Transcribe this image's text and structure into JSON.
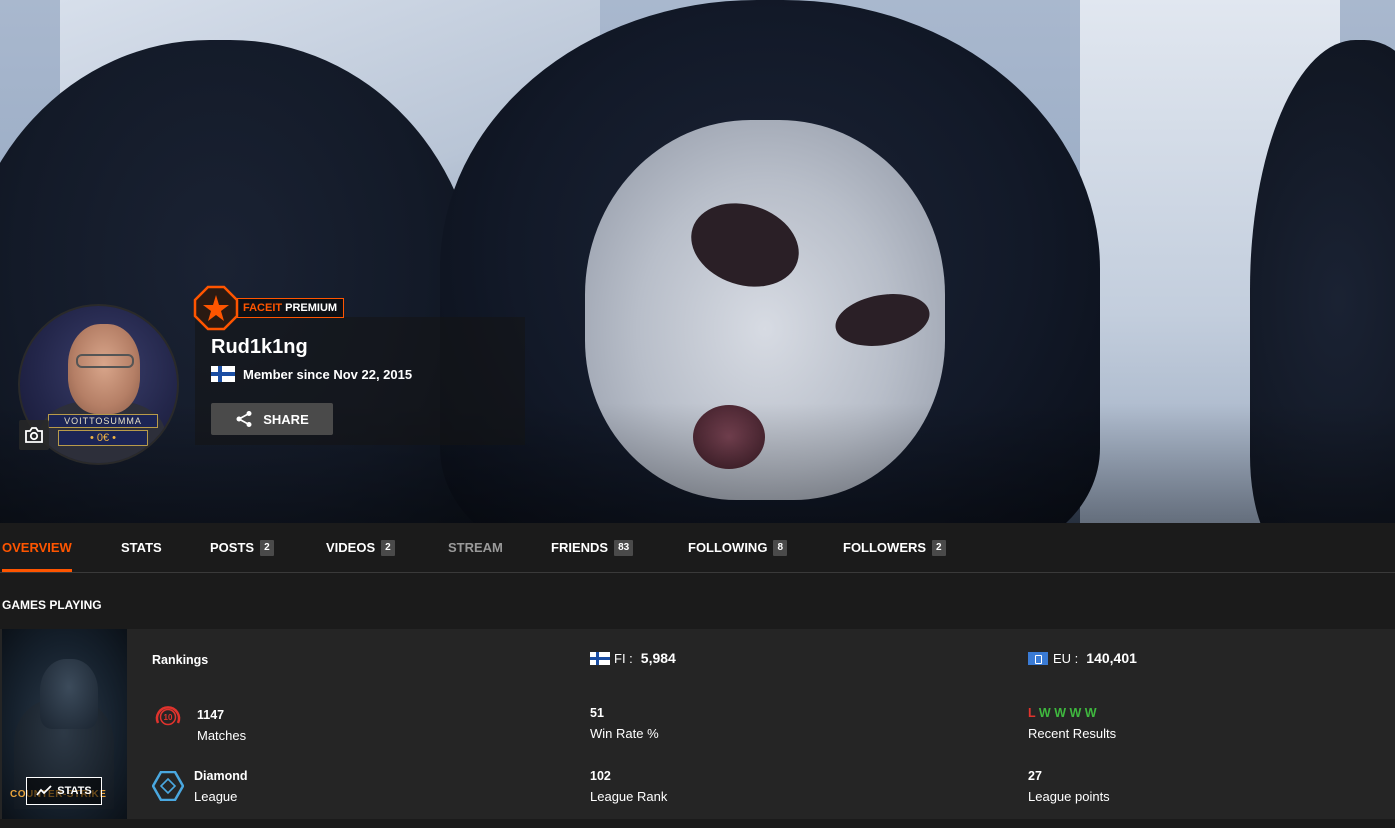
{
  "profile": {
    "premium_brand": "FACEIT",
    "premium_tier": "PREMIUM",
    "username": "Rud1k1ng",
    "member_since": "Member since Nov 22, 2015",
    "country": "FI",
    "share_label": "SHARE",
    "avatar_caption_top": "VOITTOSUMMA",
    "avatar_caption_bottom": "• 0€ •"
  },
  "tabs": [
    {
      "label": "OVERVIEW",
      "active": true
    },
    {
      "label": "STATS"
    },
    {
      "label": "POSTS",
      "count": "2"
    },
    {
      "label": "VIDEOS",
      "count": "2"
    },
    {
      "label": "STREAM"
    },
    {
      "label": "FRIENDS",
      "count": "83"
    },
    {
      "label": "FOLLOWING",
      "count": "8"
    },
    {
      "label": "FOLLOWERS",
      "count": "2"
    }
  ],
  "games_section": {
    "title": "GAMES PLAYING",
    "game": {
      "cover_logo": "COUNTER-STRIKE",
      "stats_button": "STATS"
    },
    "rankings_label": "Rankings",
    "country_rank": {
      "label": "FI :",
      "value": "5,984"
    },
    "region_rank": {
      "label": "EU :",
      "value": "140,401"
    },
    "skill_level": "10",
    "matches": {
      "value": "1147",
      "label": "Matches"
    },
    "win_rate": {
      "value": "51",
      "label": "Win Rate %"
    },
    "recent_results": {
      "results": [
        "L",
        "W",
        "W",
        "W",
        "W"
      ],
      "label": "Recent Results"
    },
    "league": {
      "value": "Diamond",
      "label": "League"
    },
    "league_rank": {
      "value": "102",
      "label": "League Rank"
    },
    "league_points": {
      "value": "27",
      "label": "League points"
    }
  },
  "colors": {
    "accent": "#ff5500",
    "loss": "#e0332d",
    "win": "#3fb83f",
    "league_diamond": "#4aa8e0"
  }
}
